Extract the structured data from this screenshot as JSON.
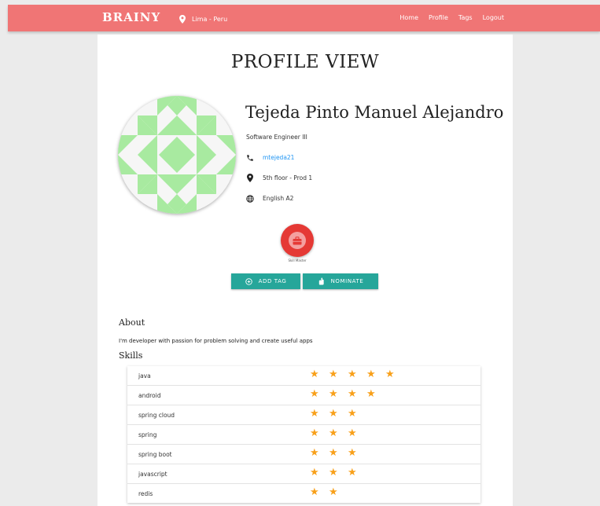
{
  "navbar": {
    "brand": "BRAINY",
    "location": "Lima - Peru",
    "links": [
      "Home",
      "Profile",
      "Tags",
      "Logout"
    ]
  },
  "profile": {
    "page_title": "PROFILE VIEW",
    "name": "Tejeda Pinto Manuel Alejandro",
    "job_title": "Software Engineer III",
    "username": "mtejeda21",
    "office": "5th floor - Prod 1",
    "language": "English A2"
  },
  "badge": {
    "caption": "Skill Master"
  },
  "actions": {
    "add_tag": "ADD TAG",
    "nominate": "NOMINATE"
  },
  "about": {
    "heading": "About",
    "text": "I'm developer with passion for problem solving and create useful apps"
  },
  "skills": {
    "heading": "Skills",
    "items": [
      {
        "name": "java",
        "rating": 5
      },
      {
        "name": "android",
        "rating": 4
      },
      {
        "name": "spring cloud",
        "rating": 3
      },
      {
        "name": "spring",
        "rating": 3
      },
      {
        "name": "spring boot",
        "rating": 3
      },
      {
        "name": "javascript",
        "rating": 3
      },
      {
        "name": "redis",
        "rating": 2
      }
    ]
  },
  "colors": {
    "navbar": "#f07575",
    "accent_button": "#26a69a",
    "star": "#f8a01a",
    "link": "#2196f3",
    "badge": "#e53935",
    "avatar_pattern": "#a8eaa0"
  },
  "icons": {
    "location": "map-marker-icon",
    "phone": "phone-icon",
    "office": "map-marker-icon",
    "language": "globe-icon",
    "badge": "briefcase-icon",
    "add_tag": "plus-circle-icon",
    "nominate": "hand-icon",
    "star": "star-icon"
  }
}
